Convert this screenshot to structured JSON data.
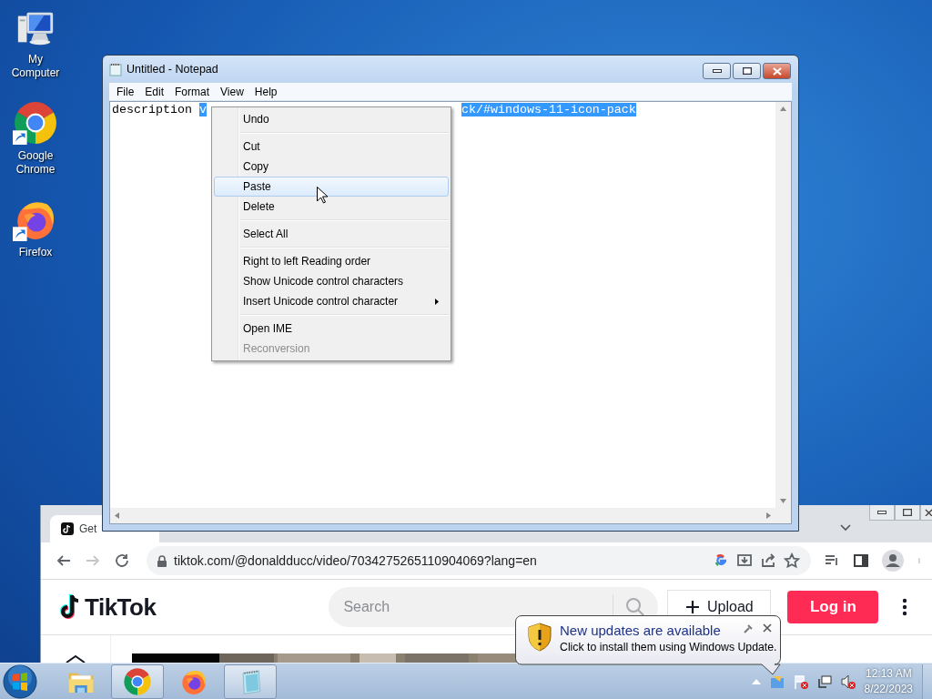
{
  "desktop_icons": [
    {
      "kind": "computer",
      "label": "My Computer"
    },
    {
      "kind": "chrome",
      "label": "Google Chrome"
    },
    {
      "kind": "firefox",
      "label": "Firefox"
    }
  ],
  "browser": {
    "tab_title": "Get",
    "url": "tiktok.com/@donaldducc/video/7034275265110904069?lang=en",
    "site": {
      "logo": "TikTok",
      "search_placeholder": "Search",
      "upload_label": "Upload",
      "login_label": "Log in"
    }
  },
  "notepad": {
    "title": "Untitled - Notepad",
    "menu": [
      "File",
      "Edit",
      "Format",
      "View",
      "Help"
    ],
    "text": "description",
    "selection_visible": [
      "v",
      "ck/#windows-11-icon-pack"
    ]
  },
  "context_menu": {
    "items": [
      {
        "kind": "item",
        "label": "Undo",
        "selected": false,
        "disabled": false,
        "submenu": false
      },
      {
        "kind": "separator"
      },
      {
        "kind": "item",
        "label": "Cut",
        "selected": false,
        "disabled": false,
        "submenu": false
      },
      {
        "kind": "item",
        "label": "Copy",
        "selected": false,
        "disabled": false,
        "submenu": false
      },
      {
        "kind": "item",
        "label": "Paste",
        "selected": true,
        "disabled": false,
        "submenu": false
      },
      {
        "kind": "item",
        "label": "Delete",
        "selected": false,
        "disabled": false,
        "submenu": false
      },
      {
        "kind": "separator"
      },
      {
        "kind": "item",
        "label": "Select All",
        "selected": false,
        "disabled": false,
        "submenu": false
      },
      {
        "kind": "separator"
      },
      {
        "kind": "item",
        "label": "Right to left Reading order",
        "selected": false,
        "disabled": false,
        "submenu": false
      },
      {
        "kind": "item",
        "label": "Show Unicode control characters",
        "selected": false,
        "disabled": false,
        "submenu": false
      },
      {
        "kind": "item",
        "label": "Insert Unicode control character",
        "selected": false,
        "disabled": false,
        "submenu": true
      },
      {
        "kind": "separator"
      },
      {
        "kind": "item",
        "label": "Open IME",
        "selected": false,
        "disabled": false,
        "submenu": false
      },
      {
        "kind": "item",
        "label": "Reconversion",
        "selected": false,
        "disabled": true,
        "submenu": false
      }
    ]
  },
  "notification": {
    "title": "New updates are available",
    "message": "Click to install them using Windows Update."
  },
  "taskbar": {
    "apps": [
      {
        "kind": "explorer",
        "active": false
      },
      {
        "kind": "chrome",
        "active": true
      },
      {
        "kind": "firefox",
        "active": false
      },
      {
        "kind": "notepad",
        "active": true
      }
    ],
    "time": "12:13 AM",
    "date": "8/22/2023"
  }
}
